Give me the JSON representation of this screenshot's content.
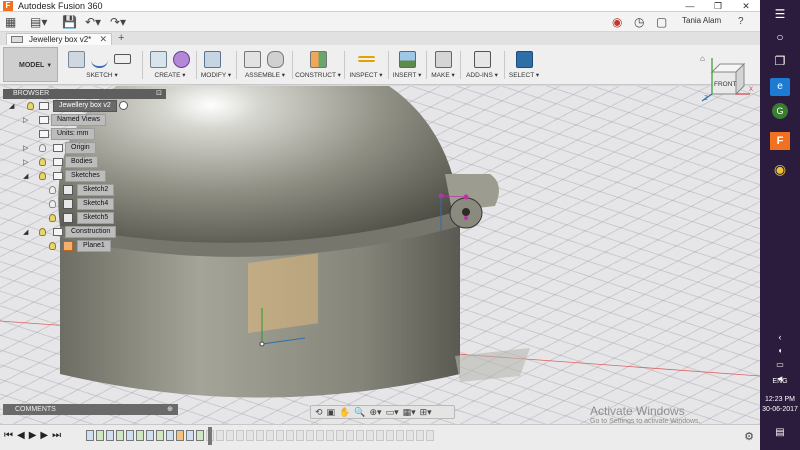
{
  "window": {
    "title": "Autodesk Fusion 360",
    "app_icon": "F",
    "controls": [
      "—",
      "❐",
      "✕"
    ]
  },
  "qat": {
    "user": "Tania Alam",
    "help": "?"
  },
  "tab": {
    "name": "Jewellery box v2*",
    "close": "✕",
    "plus": "+"
  },
  "toolbar": {
    "workspace": "MODEL",
    "groups": [
      "SKETCH",
      "CREATE",
      "MODIFY",
      "ASSEMBLE",
      "CONSTRUCT",
      "INSPECT",
      "INSERT",
      "MAKE",
      "ADD-INS",
      "SELECT"
    ]
  },
  "browser": {
    "header": "BROWSER",
    "root": "Jewellery box v2",
    "items": {
      "named_views": "Named Views",
      "units": "Units: mm",
      "origin": "Origin",
      "bodies": "Bodies",
      "sketches": "Sketches",
      "sketch2": "Sketch2",
      "sketch4": "Sketch4",
      "sketch5": "Sketch5",
      "construction": "Construction",
      "plane1": "Plane1"
    }
  },
  "viewcube": {
    "face": "FRONT",
    "axis_x": "X",
    "axis_z": "Z"
  },
  "comments": {
    "label": "COMMENTS"
  },
  "watermark": {
    "line1": "Activate Windows",
    "line2": "Go to Settings to activate Windows."
  },
  "taskbar": {
    "lang": "ENG",
    "time": "12:23 PM",
    "date": "30-06-2017"
  },
  "colors": {
    "accent": "#f27121",
    "body": "#8a8a7e",
    "taskbar": "#2b1b3d",
    "browser_header": "#5e5e5e"
  }
}
